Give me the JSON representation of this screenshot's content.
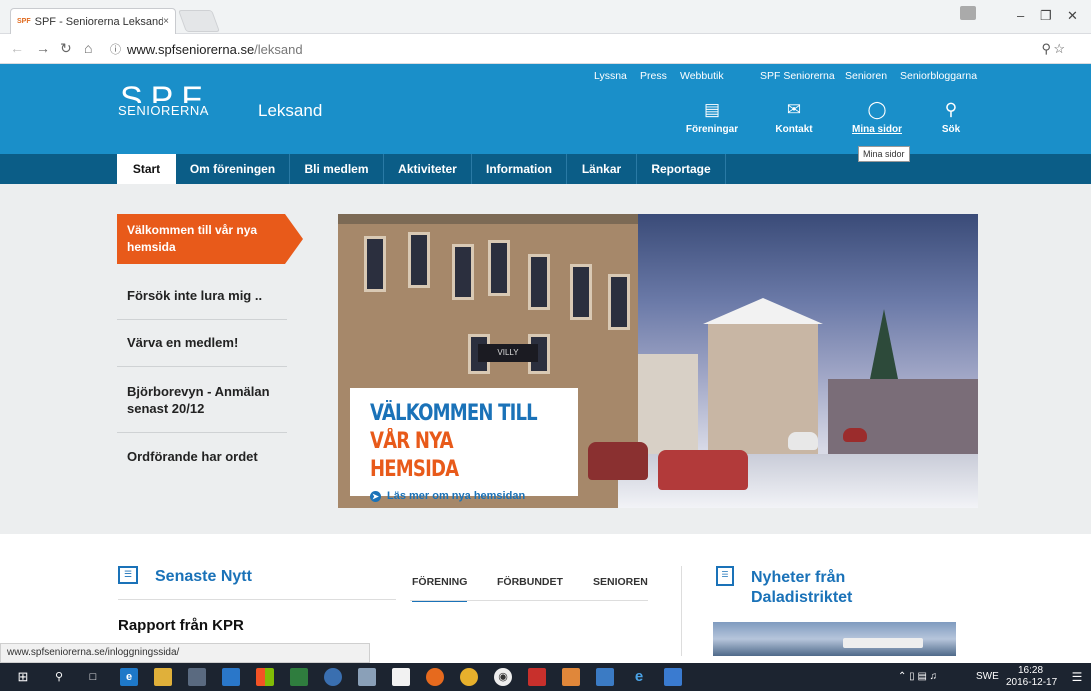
{
  "browser": {
    "tab_title": "SPF - Seniorerna Leksand",
    "tab_favicon": "SPF",
    "tab_close": "×",
    "url_domain": "www.spfseniorerna.se",
    "url_path": "/leksand",
    "status_url": "www.spfseniorerna.se/inloggningssida/"
  },
  "header": {
    "top_links": [
      "Lyssna",
      "Press",
      "Webbutik",
      "SPF Seniorerna",
      "Senioren",
      "Seniorbloggarna"
    ],
    "logo_big": "SPF",
    "logo_small": "SENIORERNA",
    "site_name": "Leksand",
    "icons": [
      {
        "label": "Föreningar",
        "icon": "list-icon"
      },
      {
        "label": "Kontakt",
        "icon": "mail-icon"
      },
      {
        "label": "Mina sidor",
        "icon": "user-icon"
      },
      {
        "label": "Sök",
        "icon": "search-icon"
      }
    ],
    "tooltip": "Mina sidor"
  },
  "nav": {
    "items": [
      "Start",
      "Om föreningen",
      "Bli medlem",
      "Aktiviteter",
      "Information",
      "Länkar",
      "Reportage"
    ]
  },
  "sidebar": {
    "active": "Välkommen till vår nya hemsida",
    "items": [
      "Försök inte lura mig ..",
      "Värva en medlem!",
      "Björborevyn - Anmälan senast 20/12",
      "Ordförande har ordet"
    ]
  },
  "hero": {
    "line1": "VÄLKOMMEN TILL",
    "line2": "VÅR NYA HEMSIDA",
    "link": "Läs mer om nya hemsidan",
    "shop_sign": "VILLY"
  },
  "news": {
    "heading": "Senaste Nytt",
    "tabs": [
      "FÖRENING",
      "FÖRBUNDET",
      "SENIOREN"
    ],
    "first_title": "Rapport från KPR",
    "dal_heading_1": "Nyheter från",
    "dal_heading_2": "Daladistriktet"
  },
  "taskbar": {
    "lang": "SWE",
    "time": "16:28",
    "date": "2016-12-17"
  },
  "colors": {
    "brand_blue": "#1a8fc9",
    "nav_dark": "#0b5d87",
    "accent_orange": "#e85a1a",
    "link_blue": "#1a72b8"
  }
}
